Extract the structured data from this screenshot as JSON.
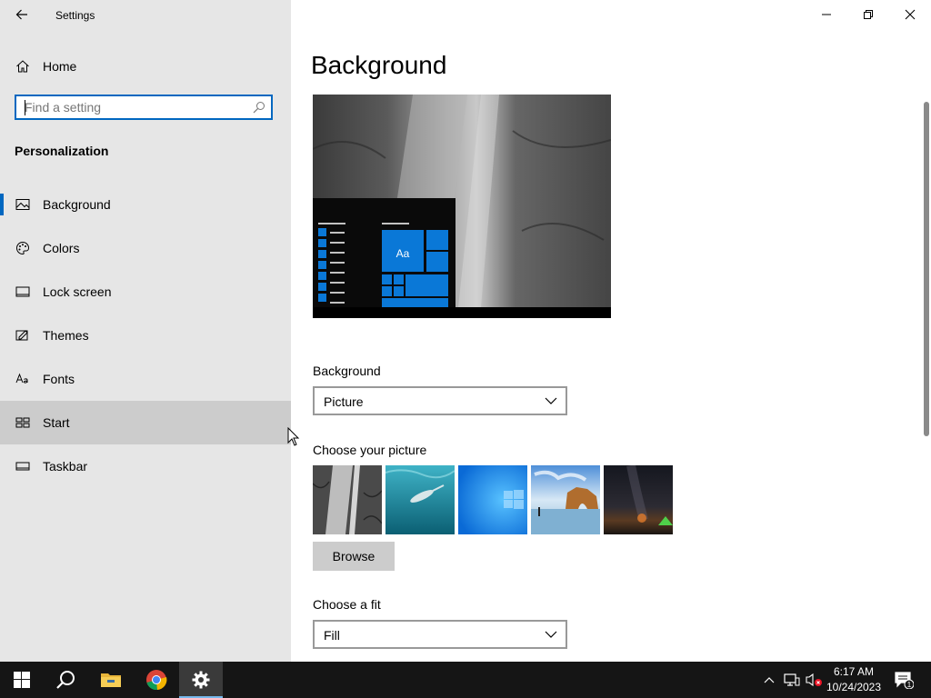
{
  "window": {
    "title": "Settings"
  },
  "nav": {
    "home_label": "Home",
    "search_placeholder": "Find a setting",
    "section_title": "Personalization",
    "items": [
      {
        "label": "Background",
        "icon": "picture-icon",
        "selected": true
      },
      {
        "label": "Colors",
        "icon": "palette-icon"
      },
      {
        "label": "Lock screen",
        "icon": "lock-screen-icon"
      },
      {
        "label": "Themes",
        "icon": "themes-icon"
      },
      {
        "label": "Fonts",
        "icon": "fonts-icon"
      },
      {
        "label": "Start",
        "icon": "start-icon",
        "hover": true
      },
      {
        "label": "Taskbar",
        "icon": "taskbar-icon"
      }
    ]
  },
  "main": {
    "page_title": "Background",
    "preview_sample_text": "Aa",
    "background_label": "Background",
    "background_value": "Picture",
    "choose_picture_label": "Choose your picture",
    "pictures": [
      "rock-cliff-picture",
      "underwater-swimmer-picture",
      "windows-blue-picture",
      "beach-rock-arch-picture",
      "night-sky-tent-picture"
    ],
    "browse_label": "Browse",
    "fit_label": "Choose a fit",
    "fit_value": "Fill"
  },
  "taskbar": {
    "time": "6:17 AM",
    "date": "10/24/2023",
    "notification_count": "1"
  },
  "colors": {
    "accent": "#0067c0",
    "nav_bg": "#e6e6e6",
    "taskbar_bg": "#151515",
    "tile_blue": "#0a78d7"
  }
}
